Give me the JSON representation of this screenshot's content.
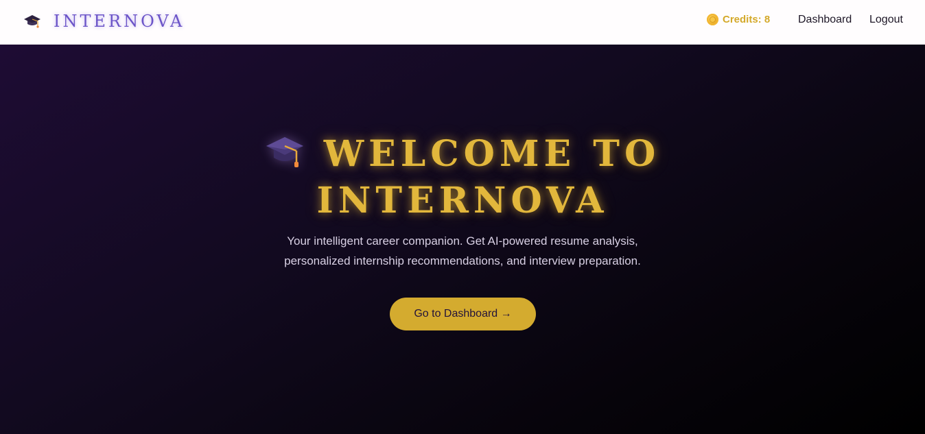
{
  "navbar": {
    "brand_name": "INTERNOVA",
    "brand_icon": "graduation-cap-icon",
    "credits_icon": "coin-icon",
    "credits_label": "Credits: 8",
    "links": {
      "dashboard": "Dashboard",
      "logout": "Logout"
    }
  },
  "hero": {
    "title_line1": "WELCOME TO",
    "title_line2": "INTERNOVA",
    "title_icon": "graduation-cap-icon",
    "subtitle_line1": "Your intelligent career companion. Get AI-powered resume analysis,",
    "subtitle_line2": "personalized internship recommendations, and interview preparation.",
    "cta_label": "Go to Dashboard →"
  },
  "colors": {
    "accent_gold": "#d4ab2f",
    "brand_purple": "#6b54c8",
    "hero_bg_dark": "#000000",
    "hero_bg_purple": "#1e0c34"
  }
}
